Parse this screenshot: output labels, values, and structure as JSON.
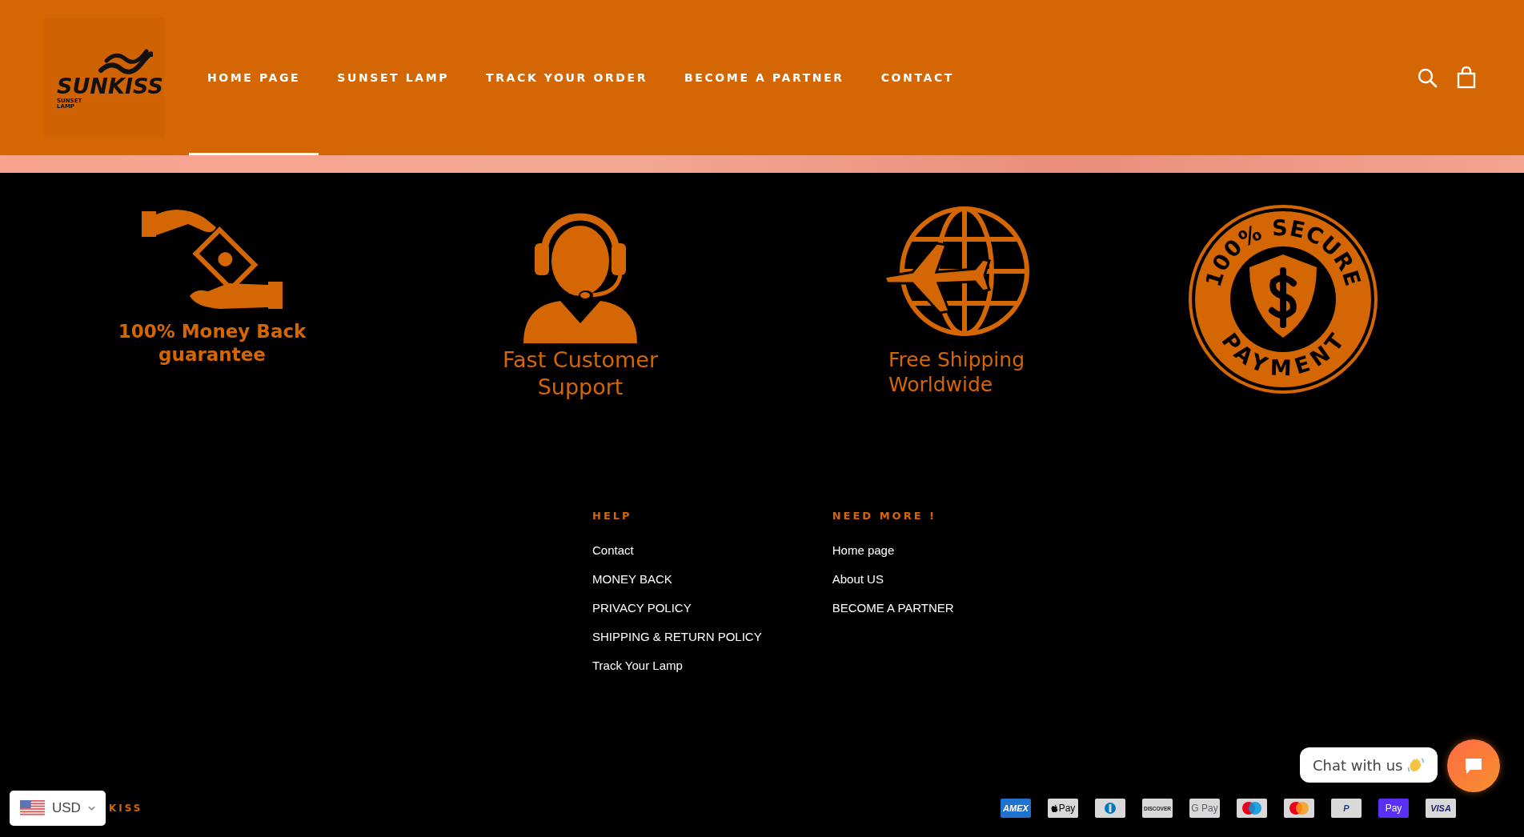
{
  "header": {
    "logo": {
      "name": "SUNKISS",
      "tagline": "SUNSET LAMP"
    },
    "nav": [
      {
        "label": "HOME PAGE",
        "selected": true
      },
      {
        "label": "SUNSET LAMP",
        "selected": false
      },
      {
        "label": "TRACK YOUR ORDER",
        "selected": false
      },
      {
        "label": "BECOME A PARTNER",
        "selected": false
      },
      {
        "label": "CONTACT",
        "selected": false
      }
    ]
  },
  "features": [
    {
      "kind": "money",
      "lines": [
        "100% Money Back",
        "guarantee"
      ]
    },
    {
      "kind": "support",
      "lines": [
        "Fast Customer",
        "Support"
      ]
    },
    {
      "kind": "shipping",
      "lines": [
        "Free Shipping",
        "Worldwide"
      ]
    },
    {
      "kind": "secure",
      "lines": [
        "100% SECURE",
        "PAYMENT"
      ]
    }
  ],
  "footer_columns": [
    {
      "title": "HELP",
      "links": [
        "Contact",
        "MONEY BACK",
        "PRIVACY POLICY",
        "SHIPPING & RETURN POLICY",
        "Track Your Lamp"
      ]
    },
    {
      "title": "NEED MORE !",
      "links": [
        "Home page",
        "About US",
        "BECOME A PARTNER"
      ]
    }
  ],
  "copyright": "KISS",
  "currency": {
    "value": "USD"
  },
  "payment_methods": [
    {
      "kind": "amex",
      "label": "AMEX"
    },
    {
      "kind": "applepay",
      "label": "Pay"
    },
    {
      "kind": "diners"
    },
    {
      "kind": "discover",
      "label": "DISCOVER"
    },
    {
      "kind": "googlepay",
      "label": "G Pay"
    },
    {
      "kind": "maestro"
    },
    {
      "kind": "mastercard"
    },
    {
      "kind": "paypal",
      "label": "P"
    },
    {
      "kind": "shoppay",
      "label": "Pay"
    },
    {
      "kind": "visa",
      "label": "VISA"
    }
  ],
  "chat": {
    "label": "Chat with us"
  }
}
